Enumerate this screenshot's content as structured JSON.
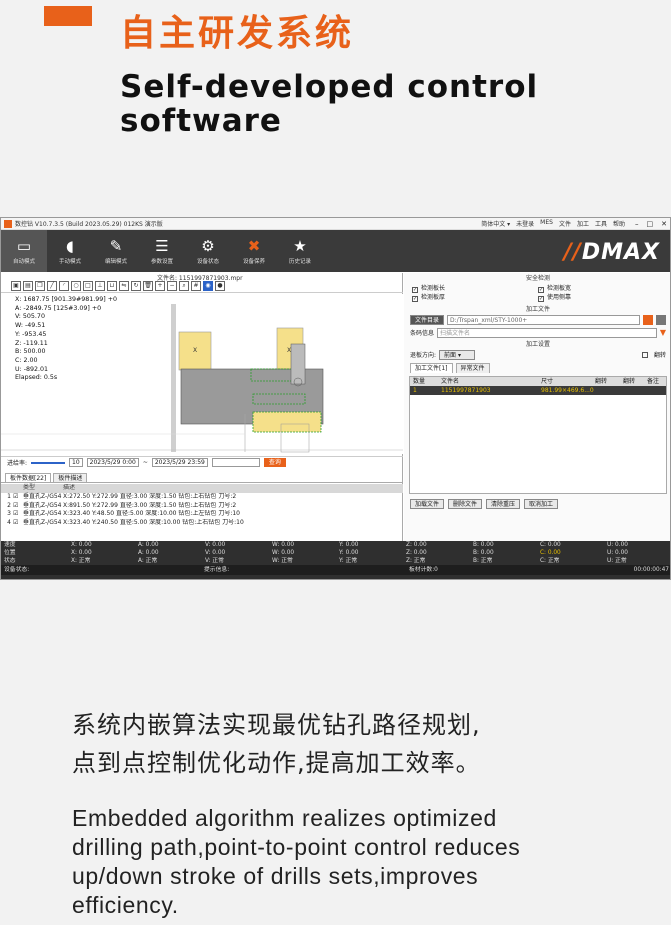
{
  "header": {
    "title_cn": "自主研发系统",
    "title_en": "Self-developed control software",
    "title_en_line1": "Self-developed control",
    "title_en_line2": "software"
  },
  "window": {
    "title": "数控钻 V10.7.3.5 (Build 2023.05.29) 012KS 演示版",
    "menu": [
      "简体中文 ▾",
      "未登录",
      "MES",
      "文件",
      "加工",
      "工具",
      "帮助"
    ],
    "brand": "DMAX",
    "ribbon": [
      {
        "label": "自动模式",
        "icon": "monitor-icon"
      },
      {
        "label": "手动模式",
        "icon": "mouse-icon"
      },
      {
        "label": "编辑模式",
        "icon": "edit-icon"
      },
      {
        "label": "参数设置",
        "icon": "list-icon"
      },
      {
        "label": "设备状态",
        "icon": "gear-icon"
      },
      {
        "label": "设备保养",
        "icon": "tools-icon"
      },
      {
        "label": "历史记录",
        "icon": "star-icon"
      }
    ],
    "file_name": "文件名: 1151997871903.mpr",
    "coords": [
      "X: 1687.75 [901.39#981.99] +0",
      "A: -2849.75 [125#3.09] +0",
      "V: 505.70",
      "W: -49.51",
      "Y: -953.45",
      "Z: -119.11",
      "B: 500.00",
      "C: 2.00",
      "U: -892.01",
      "Elapsed: 0.5s"
    ],
    "filter": {
      "label": "进给率:",
      "count": "10",
      "date_from": "2023/5/29 0:00",
      "date_to": "2023/5/29 23:59",
      "query": "查询"
    },
    "tabs": [
      "板件数据[22]",
      "板件描述"
    ],
    "grid": {
      "headers": [
        "",
        "",
        "类型",
        "描述"
      ],
      "rows": [
        {
          "no": "1",
          "type": "垂直孔Z-/G54",
          "desc": "X:272.50 Y:272.99 直径:3.00 深度:1.50 钻包:上右钻包 刀号:2"
        },
        {
          "no": "2",
          "type": "垂直孔Z-/G54",
          "desc": "X:891.50 Y:272.99 直径:3.00 深度:1.50 钻包:上右钻包 刀号:2"
        },
        {
          "no": "3",
          "type": "垂直孔Z-/G54",
          "desc": "X:323.40 Y:48.50 直径:5.00 深度:10.00 钻包:上左钻包 刀号:10"
        },
        {
          "no": "4",
          "type": "垂直孔Z-/G54",
          "desc": "X:323.40 Y:240.50 直径:5.00 深度:10.00 钻包:上右钻包 刀号:10"
        }
      ]
    },
    "right": {
      "safety_title": "安全检测",
      "checks": [
        "检测板长",
        "检测板宽",
        "检测板厚",
        "使用侧靠"
      ],
      "process_file_title": "加工文件",
      "file_dir_button": "文件目录",
      "file_dir_path": "D:/Trspan_xml/STY-1000+",
      "barcode_label": "条码信息",
      "barcode_placeholder": "扫描文件名",
      "process_setting_title": "加工设置",
      "edge_label": "退板方向:",
      "edge_value": "前面",
      "flip_label": "翻转",
      "file_tabs": [
        "加工文件[1]",
        "异常文件"
      ],
      "table_headers": [
        "数量",
        "文件名",
        "尺寸",
        "翻转",
        "翻转",
        "备注"
      ],
      "table_row": [
        "1",
        "1151997871903",
        "981.99×469.6...0",
        "",
        "",
        ""
      ],
      "buttons": [
        "加载文件",
        "删除文件",
        "清除重压",
        "取消加工"
      ]
    },
    "status_rows": [
      [
        "速度",
        "X: 0.00",
        "A: 0.00",
        "V: 0.00",
        "W: 0.00",
        "Y: 0.00",
        "Z: 0.00",
        "B: 0.00",
        "C: 0.00",
        "U: 0.00"
      ],
      [
        "位置",
        "X: 0.00",
        "A: 0.00",
        "V: 0.00",
        "W: 0.00",
        "Y: 0.00",
        "Z: 0.00",
        "B: 0.00",
        "C: 0.00",
        "U: 0.00"
      ],
      [
        "状态",
        "X: 正常",
        "A: 正常",
        "V: 正常",
        "W: 正常",
        "Y: 正常",
        "Z: 正常",
        "B: 正常",
        "C: 正常",
        "U: 正常"
      ]
    ],
    "status_bar": {
      "device": "设备状态:",
      "prompt": "提示信息:",
      "count": "板材计数:0",
      "timer": "00:00:00:47"
    },
    "colors": {
      "accent": "#e8611a",
      "ribbon": "#3a3a3a",
      "panel_yellow": "#f5e08a",
      "selection": "#2c63c8"
    }
  },
  "description": {
    "cn_line1": "系统内嵌算法实现最优钻孔路径规划,",
    "cn_line2": "点到点控制优化动作,提高加工效率。",
    "en_line1": "Embedded algorithm realizes optimized",
    "en_line2": "drilling path,point-to-point control reduces",
    "en_line3": "up/down stroke of drills sets,improves",
    "en_line4": "efficiency."
  }
}
